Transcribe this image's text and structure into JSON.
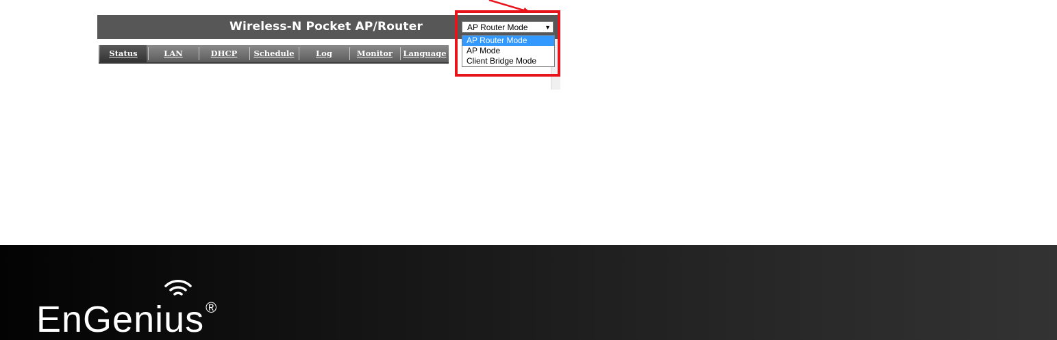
{
  "header": {
    "title": "Wireless-N Pocket AP/Router"
  },
  "nav": {
    "tabs": [
      {
        "label": "Status",
        "active": true
      },
      {
        "label": "LAN",
        "active": false
      },
      {
        "label": "DHCP",
        "active": false
      },
      {
        "label": "Schedule",
        "active": false
      },
      {
        "label": "Log",
        "active": false
      },
      {
        "label": "Monitor",
        "active": false
      },
      {
        "label": "Language",
        "active": false
      }
    ]
  },
  "mode_select": {
    "value": "AP Router Mode",
    "options": [
      {
        "label": "AP Router Mode",
        "selected": true
      },
      {
        "label": "AP Mode",
        "selected": false
      },
      {
        "label": "Client Bridge Mode",
        "selected": false
      }
    ]
  },
  "annotation": {
    "highlight_color": "#e8141b"
  },
  "footer": {
    "brand": "EnGenius",
    "registered": "®"
  },
  "colors": {
    "title_bar": "#575757",
    "selection": "#3399ff"
  }
}
